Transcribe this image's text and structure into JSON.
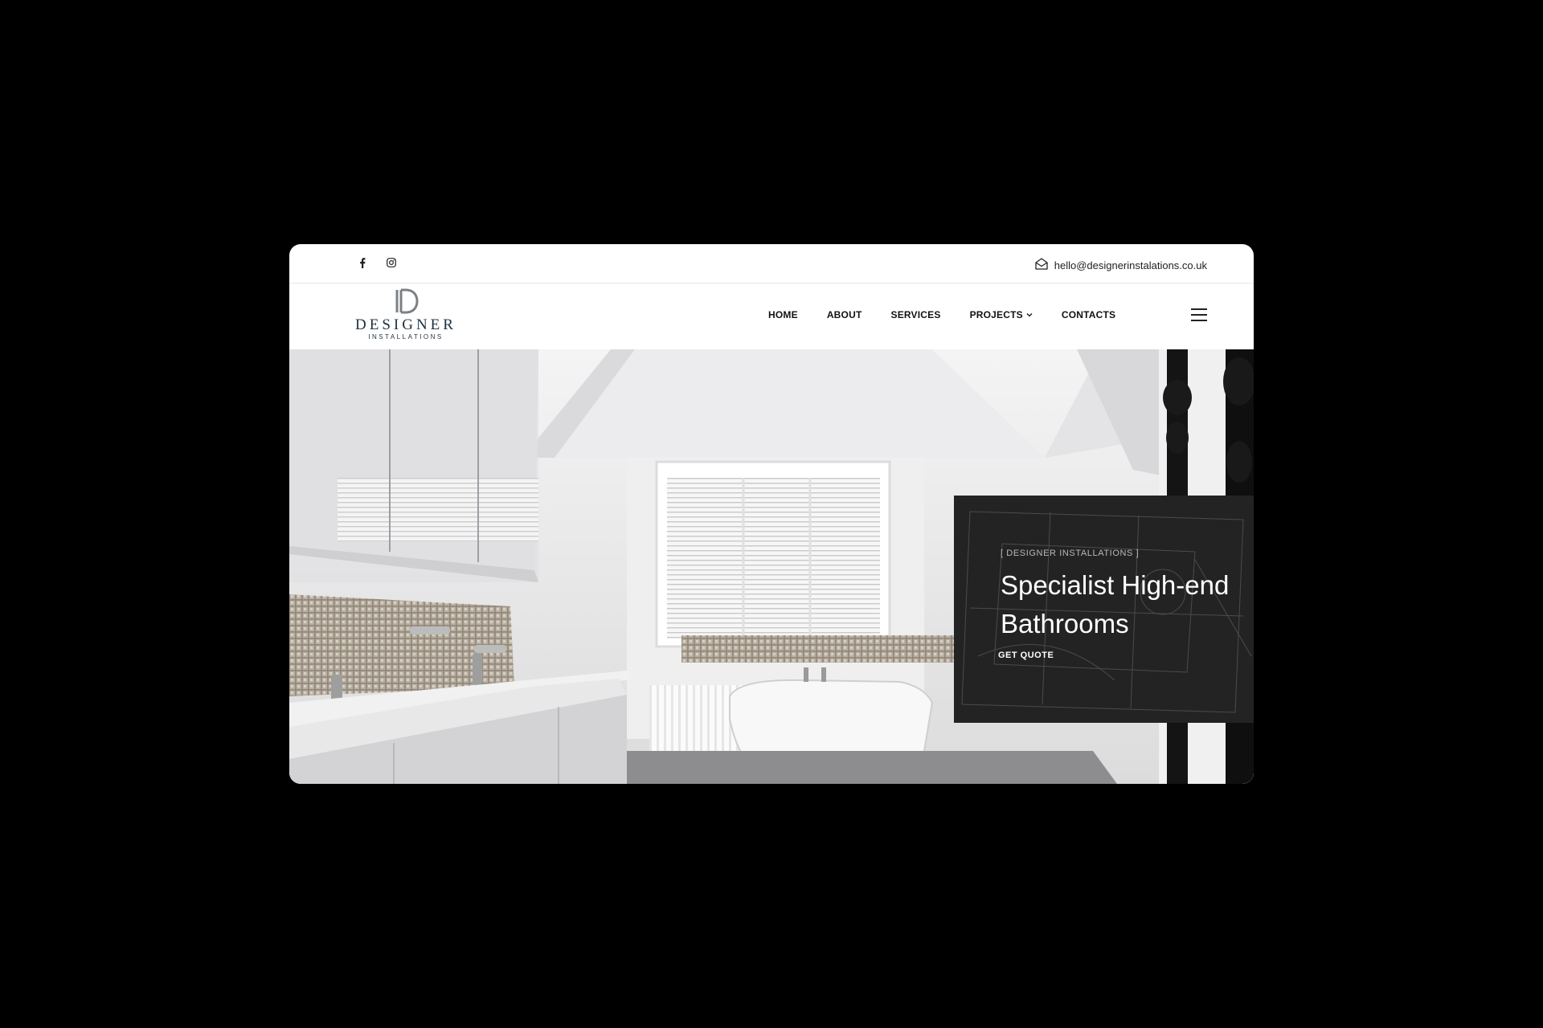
{
  "topbar": {
    "social": [
      {
        "icon": "facebook-icon",
        "glyph": "f"
      },
      {
        "icon": "instagram-icon"
      }
    ],
    "email": "hello@designerinstalations.co.uk"
  },
  "logo": {
    "title": "DESIGNER",
    "subtitle": "INSTALLATIONS"
  },
  "nav": {
    "items": [
      {
        "label": "HOME"
      },
      {
        "label": "ABOUT"
      },
      {
        "label": "SERVICES"
      },
      {
        "label": "PROJECTS"
      },
      {
        "label": "CONTACTS"
      }
    ]
  },
  "hero": {
    "eyebrow": "[ DESIGNER INSTALLATIONS ]",
    "title": "Specialist High-end Bathrooms",
    "cta": "GET QUOTE"
  },
  "colors": {
    "brand": "#1f3140",
    "card": "#232323"
  }
}
